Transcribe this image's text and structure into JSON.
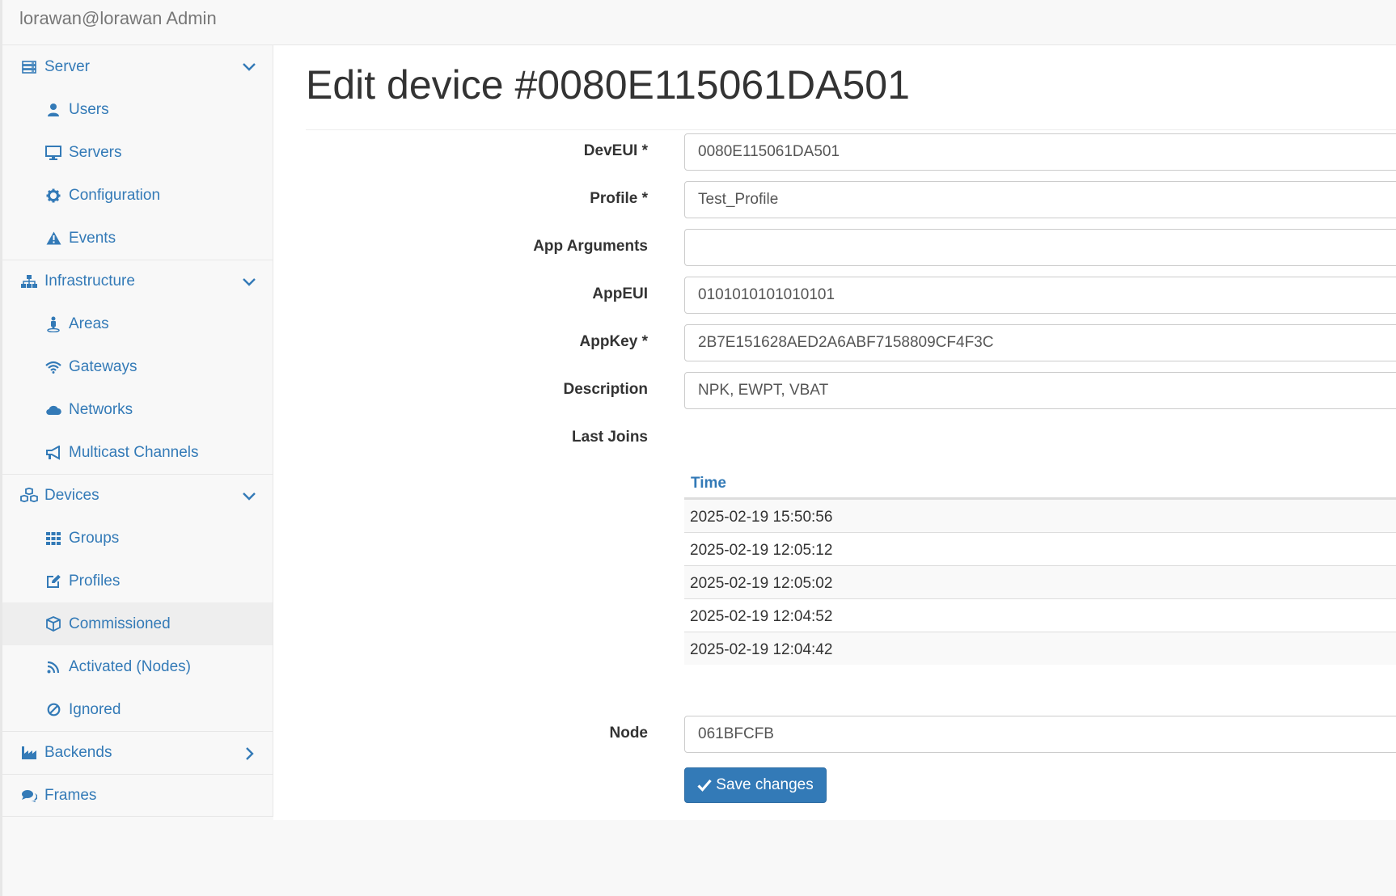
{
  "brand": "lorawan@lorawan Admin",
  "sidebar": {
    "server": "Server",
    "users": "Users",
    "servers": "Servers",
    "configuration": "Configuration",
    "events": "Events",
    "infrastructure": "Infrastructure",
    "areas": "Areas",
    "gateways": "Gateways",
    "networks": "Networks",
    "multicast": "Multicast Channels",
    "devices": "Devices",
    "groups": "Groups",
    "profiles": "Profiles",
    "commissioned": "Commissioned",
    "activated": "Activated (Nodes)",
    "ignored": "Ignored",
    "backends": "Backends",
    "frames": "Frames"
  },
  "page": {
    "title": "Edit device #0080E115061DA501"
  },
  "form": {
    "deveui_label": "DevEUI *",
    "deveui_value": "0080E115061DA501",
    "profile_label": "Profile *",
    "profile_value": "Test_Profile",
    "appargs_label": "App Arguments",
    "appargs_value": "",
    "appeui_label": "AppEUI",
    "appeui_value": "0101010101010101",
    "appkey_label": "AppKey *",
    "appkey_value": "2B7E151628AED2A6ABF7158809CF4F3C",
    "description_label": "Description",
    "description_value": "NPK, EWPT, VBAT",
    "lastjoins_label": "Last Joins",
    "joins_header": "Time",
    "joins": [
      "2025-02-19 15:50:56",
      "2025-02-19 12:05:12",
      "2025-02-19 12:05:02",
      "2025-02-19 12:04:52",
      "2025-02-19 12:04:42"
    ],
    "node_label": "Node",
    "node_value": "061BFCFB",
    "save_label": "Save changes"
  },
  "colors": {
    "link": "#337ab7",
    "primary": "#337ab7",
    "sidebar_bg": "#f8f8f8",
    "active_bg": "#eeeeee"
  }
}
